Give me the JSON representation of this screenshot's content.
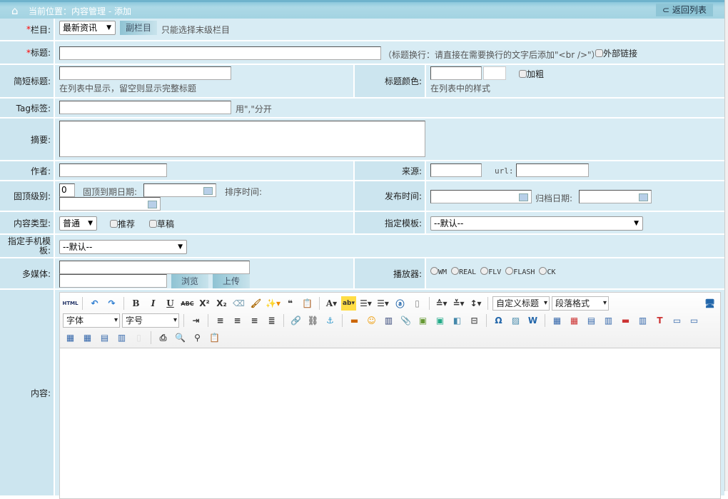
{
  "header": {
    "location": "当前位置：内容管理 - 添加",
    "back": "返回列表"
  },
  "rows": {
    "column": {
      "label": "栏目:",
      "select": "最新资讯",
      "sub_button": "副栏目",
      "hint": "只能选择末级栏目"
    },
    "title": {
      "label": "标题:",
      "value": "",
      "hint": "（标题换行：请直接在需要换行的文字后添加\"<br />\"）",
      "external": "外部链接"
    },
    "short_title": {
      "label": "简短标题:",
      "hint": "在列表中显示，留空则显示完整标题"
    },
    "title_color": {
      "label": "标题颜色:",
      "bold": "加粗",
      "hint": "在列表中的样式"
    },
    "tag": {
      "label": "Tag标签:",
      "hint": "用\",\"分开"
    },
    "summary": {
      "label": "摘要:"
    },
    "author": {
      "label": "作者:"
    },
    "source": {
      "label": "来源:",
      "url_label": "url:"
    },
    "top_level": {
      "label": "固顶级别:",
      "value": "0",
      "expire_label": "固顶到期日期:",
      "sort_label": "排序时间:"
    },
    "publish": {
      "label": "发布时间:",
      "archive_label": "归档日期:"
    },
    "content_type": {
      "label": "内容类型:",
      "select": "普通",
      "recommend": "推荐",
      "draft": "草稿"
    },
    "template": {
      "label": "指定模板:",
      "select": "--默认--"
    },
    "mobile_template": {
      "label": "指定手机模板:",
      "select": "--默认--"
    },
    "media": {
      "label": "多媒体:",
      "browse": "浏览",
      "upload": "上传"
    },
    "player": {
      "label": "播放器:",
      "options": [
        "WM",
        "REAL",
        "FLV",
        "FLASH",
        "CK"
      ]
    },
    "content": {
      "label": "内容:"
    }
  },
  "editor": {
    "html": "HTML",
    "custom_title": "自定义标题",
    "paragraph": "段落格式",
    "font": "字体",
    "size": "字号"
  }
}
